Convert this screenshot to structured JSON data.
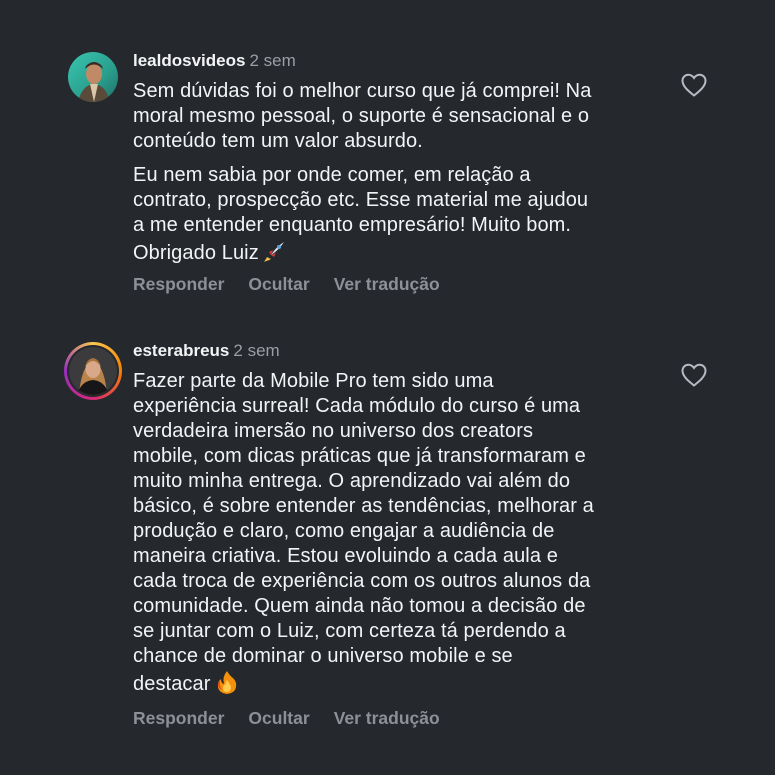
{
  "comments": [
    {
      "username": "lealdosvideos",
      "time": "2 sem",
      "paragraph1": [
        "Sem dúvidas foi o melhor curso que já comprei! Na",
        "moral mesmo pessoal, o suporte é sensacional e o",
        "conteúdo tem um valor absurdo."
      ],
      "paragraph2": [
        "Eu nem sabia por onde comer, em relação a",
        "contrato, prospecção etc. Esse material me ajudou",
        "a me entender enquanto empresário! Muito bom.",
        "Obrigado Luiz"
      ],
      "emoji": "rocket-emoji",
      "actions": {
        "reply": "Responder",
        "hide": "Ocultar",
        "translate": "Ver tradução"
      },
      "like_icon": "heart-outline-icon"
    },
    {
      "username": "esterabreus",
      "time": "2 sem",
      "paragraph1": [
        "Fazer parte da Mobile Pro tem sido uma",
        "experiência surreal! Cada módulo do curso é uma",
        "verdadeira imersão no universo dos creators",
        "mobile, com dicas práticas que já transformaram e",
        "muito minha entrega. O aprendizado vai além do",
        "básico, é sobre entender as tendências, melhorar a",
        "produção e claro, como engajar a audiência de",
        "maneira criativa. Estou evoluindo a cada aula e",
        "cada troca de experiência com os outros alunos da",
        "comunidade. Quem ainda não tomou a decisão de",
        "se juntar com o Luiz, com certeza tá perdendo a",
        "chance de dominar o universo mobile e se",
        "destacar"
      ],
      "emoji": "fire-emoji",
      "actions": {
        "reply": "Responder",
        "hide": "Ocultar",
        "translate": "Ver tradução"
      },
      "like_icon": "heart-outline-icon",
      "avatar_ring": true
    }
  ],
  "colors": {
    "background": "#25282d",
    "text": "#f3f4f6",
    "muted": "#9b9ea4",
    "action": "#8d9096"
  }
}
